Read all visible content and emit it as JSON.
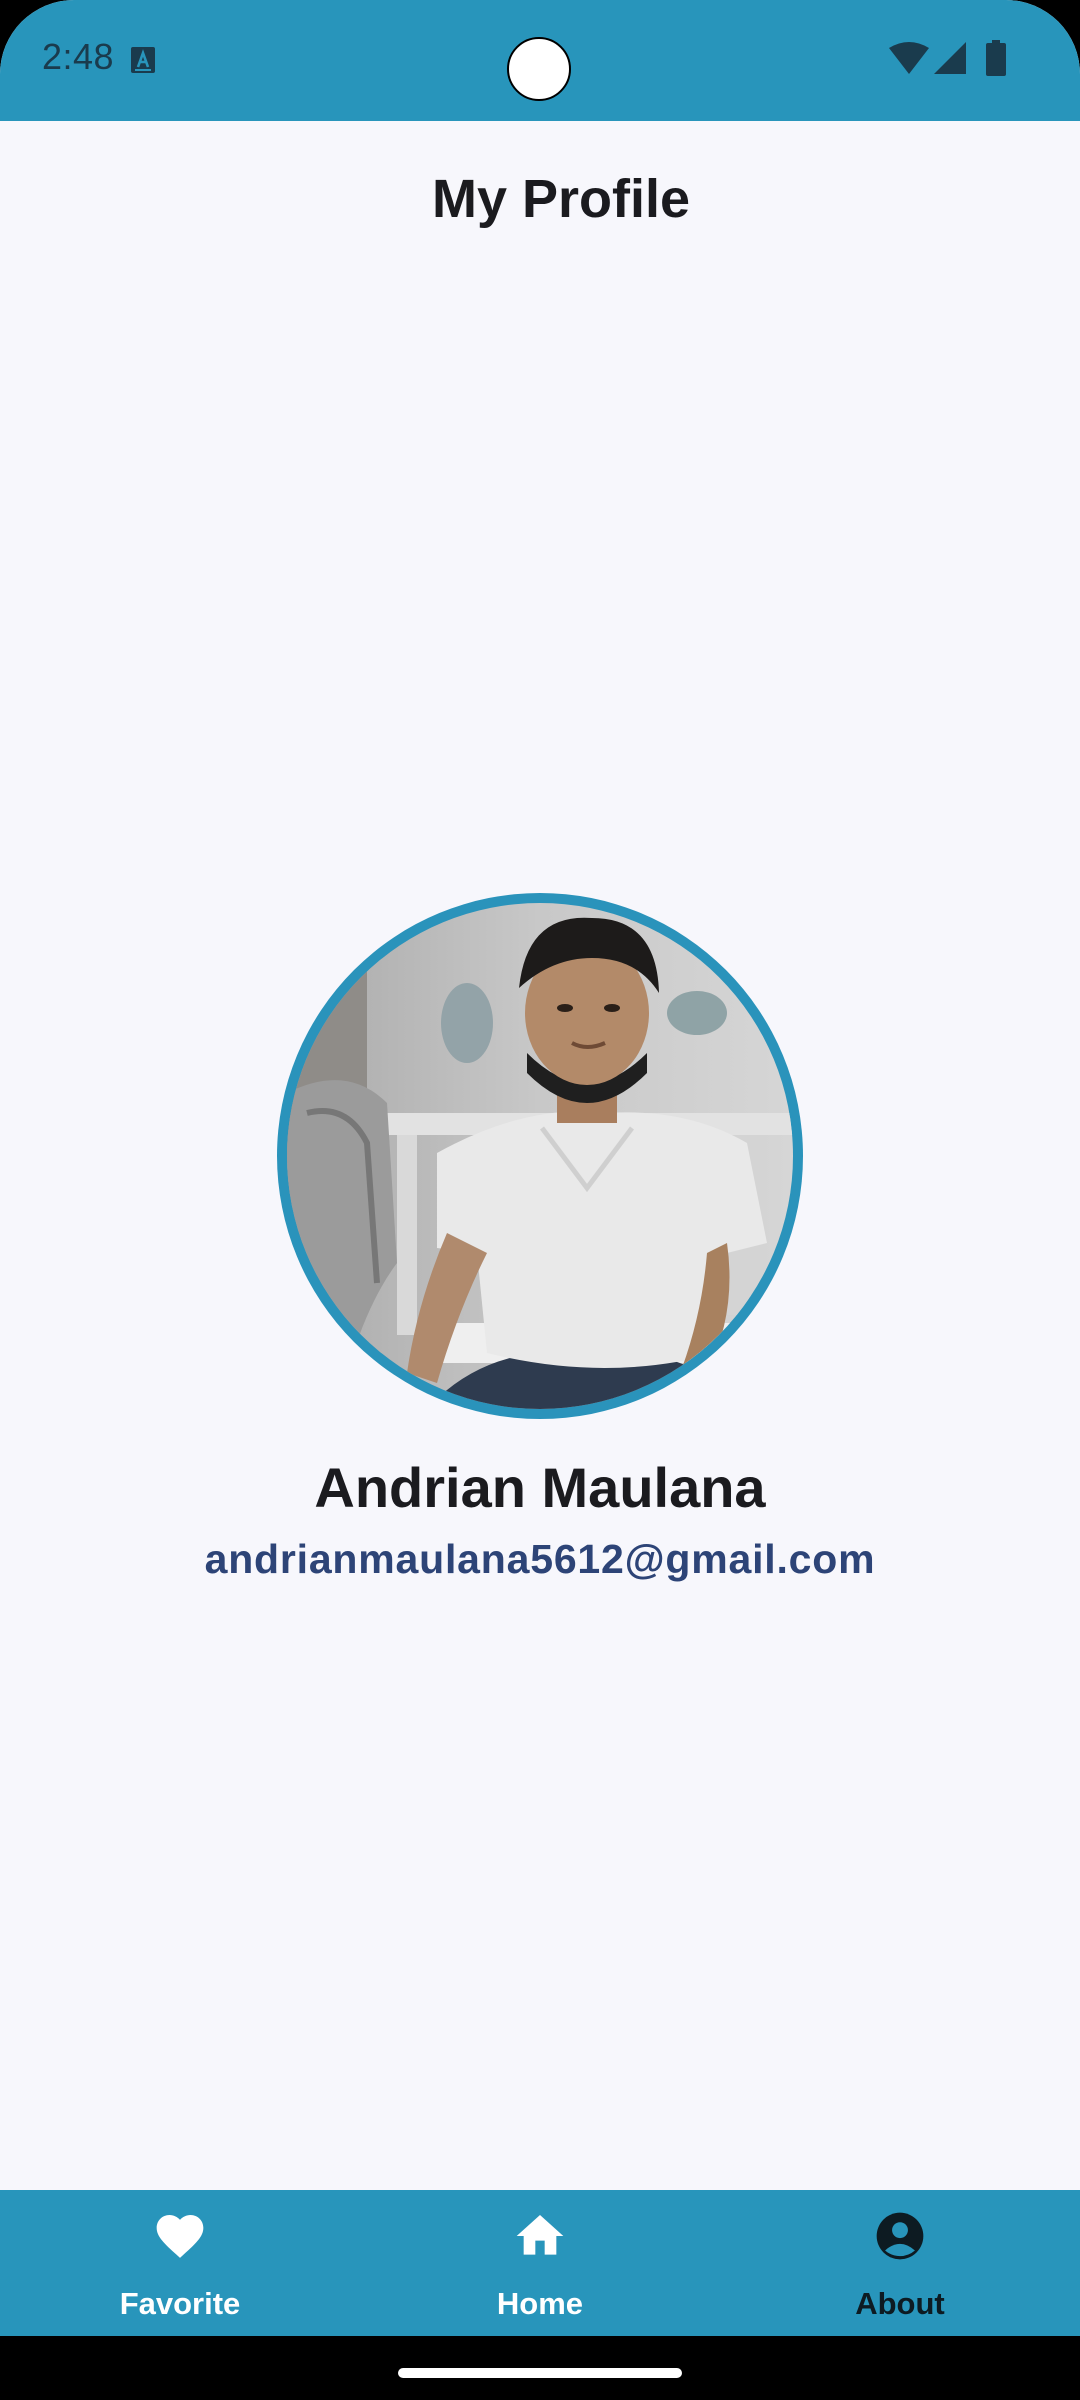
{
  "status_bar": {
    "time": "2:48",
    "notification_icon": "a-badge-icon",
    "wifi_icon": "wifi-icon",
    "signal_icon": "cell-signal-icon",
    "battery_icon": "battery-icon",
    "background_color": "#2895bb"
  },
  "header": {
    "title": "My Profile"
  },
  "profile": {
    "name": "Andrian Maulana",
    "email": "andrianmaulana5612@gmail.com",
    "avatar_border_color": "#2a93bb"
  },
  "bottom_nav": {
    "background_color": "#2895bb",
    "items": [
      {
        "label": "Favorite",
        "icon": "heart-icon",
        "active": false
      },
      {
        "label": "Home",
        "icon": "home-icon",
        "active": false
      },
      {
        "label": "About",
        "icon": "account-circle-icon",
        "active": true
      }
    ]
  }
}
